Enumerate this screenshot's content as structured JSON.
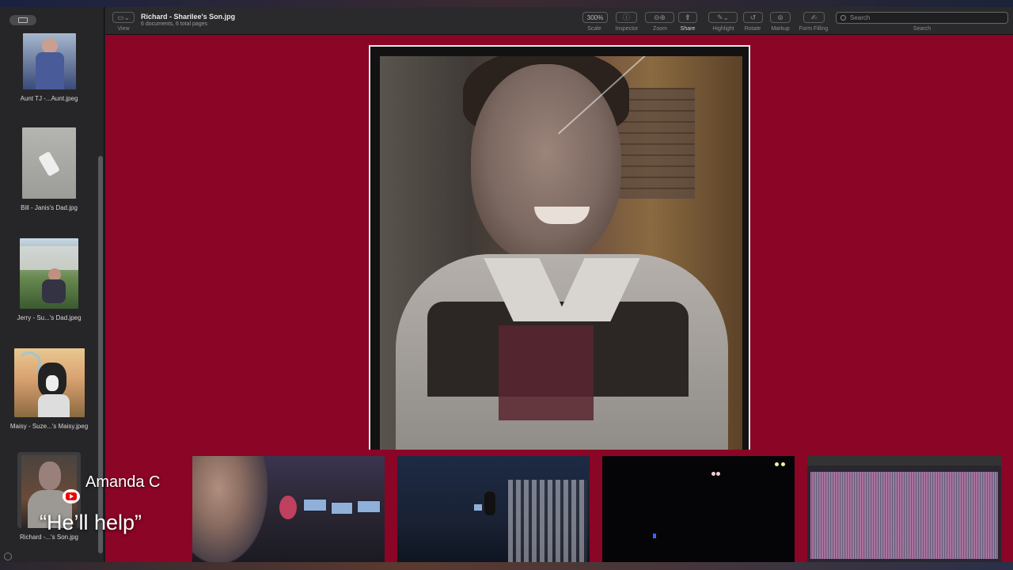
{
  "window": {
    "title": "Richard - Sharilee's Son.jpg",
    "subtitle": "6 documents, 6 total pages"
  },
  "toolbar": {
    "view_label": "View",
    "scale_value": "300%",
    "scale_label": "Scale",
    "inspector_label": "Inspector",
    "zoom_label": "Zoom",
    "share_label": "Share",
    "highlight_label": "Highlight",
    "rotate_label": "Rotate",
    "markup_label": "Markup",
    "form_filling_label": "Form Filling",
    "search_placeholder": "Search",
    "search_label": "Search"
  },
  "sidebar": {
    "items": [
      {
        "label": "Aunt TJ -...Aunt.jpeg"
      },
      {
        "label": "Bill - Janis's Dad.jpg"
      },
      {
        "label": "Jerry - Su...'s Dad.jpeg"
      },
      {
        "label": "Maisy - Suze...'s Maisy.jpeg"
      },
      {
        "label": "Richard -...'s Son.jpg",
        "selected": true
      }
    ]
  },
  "overlay": {
    "speaker_name": "Amanda C",
    "caption": "“He’ll help”",
    "platform_icon": "youtube-icon"
  },
  "colors": {
    "content_bg": "#8b0526",
    "sidebar_bg": "#262628",
    "toolbar_bg": "#2a2a2d"
  }
}
